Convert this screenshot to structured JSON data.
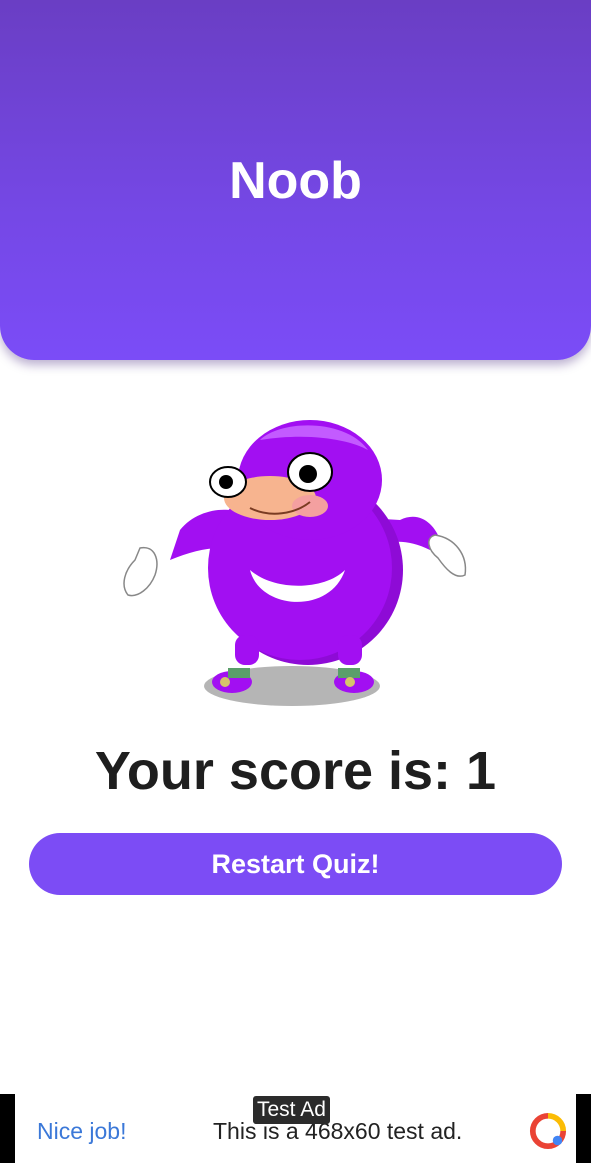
{
  "header": {
    "title": "Noob"
  },
  "result": {
    "mascot_icon": "knuckles-mascot-icon",
    "score_text": "Your score is: 1"
  },
  "actions": {
    "restart_label": "Restart Quiz!"
  },
  "ad": {
    "label": "Test Ad",
    "headline": "Nice job!",
    "body": "This is a 468x60 test ad.",
    "icon": "adchoices-icon"
  },
  "colors": {
    "header": "#7548e6",
    "button": "#7c4cf5",
    "mascot": "#a20ff2",
    "text": "#1e1e1e"
  }
}
